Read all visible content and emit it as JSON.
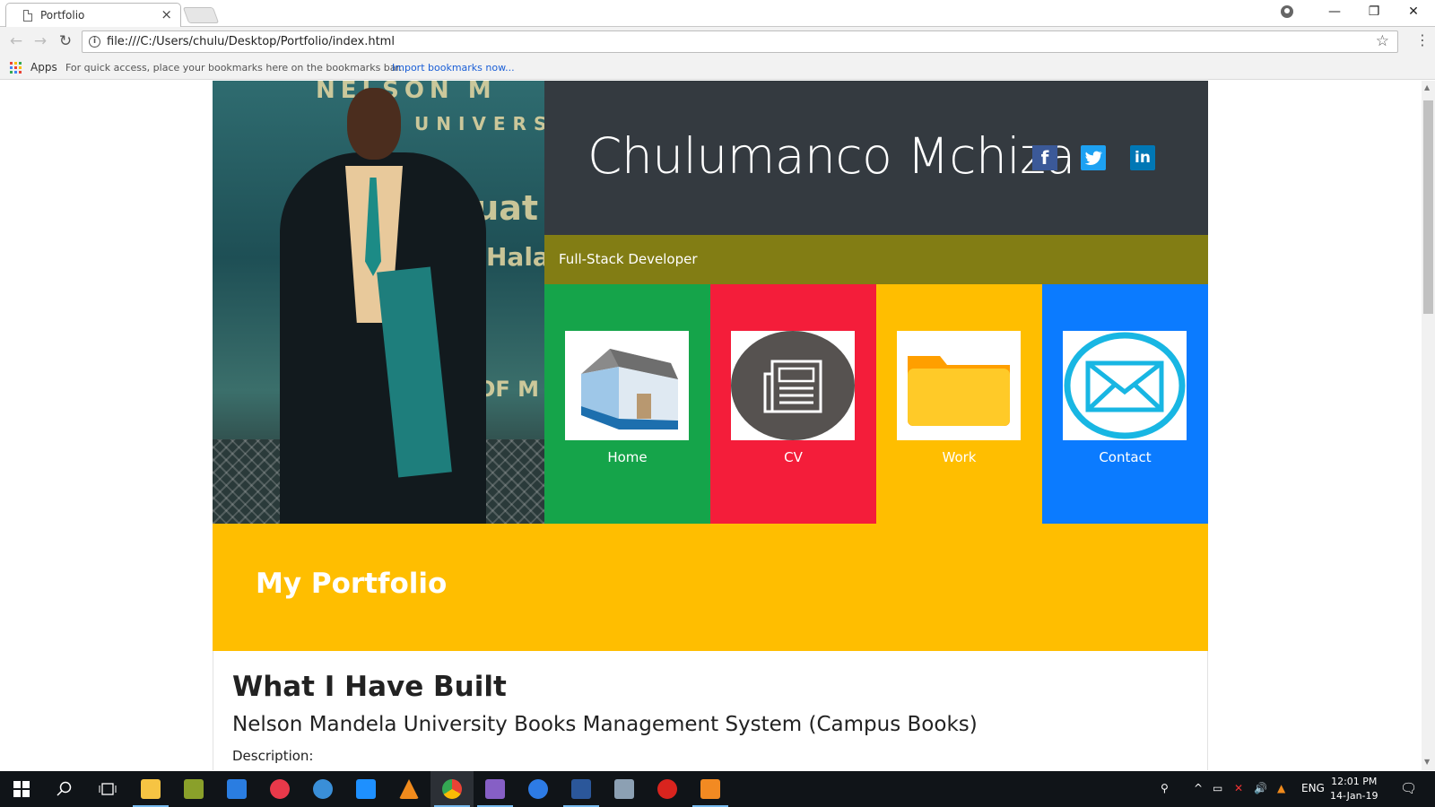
{
  "browser": {
    "tab_title": "Portfolio",
    "tab_close": "×",
    "url": "file:///C:/Users/chulu/Desktop/Portfolio/index.html",
    "window_controls": {
      "minimize": "—",
      "maximize": "❐",
      "close": "✕"
    }
  },
  "bookmarks": {
    "apps_label": "Apps",
    "hint": "For quick access, place your bookmarks here on the bookmarks bar.",
    "import_link": "Import bookmarks now..."
  },
  "header": {
    "name": "Chulumanco Mchiza",
    "subtitle": "Full-Stack Developer",
    "social": [
      {
        "icon": "facebook-icon",
        "glyph": "f",
        "color": "#3b5998"
      },
      {
        "icon": "twitter-icon",
        "glyph": "🐦",
        "color": "#1da1f2"
      },
      {
        "icon": "linkedin-icon",
        "glyph": "in",
        "color": "#0077b5"
      }
    ]
  },
  "nav_tiles": [
    {
      "label": "Home",
      "icon": "house-icon",
      "color": "#15a44a"
    },
    {
      "label": "CV",
      "icon": "newspaper-icon",
      "color": "#f41d3a"
    },
    {
      "label": "Work",
      "icon": "folder-icon",
      "color": "#ffbe00"
    },
    {
      "label": "Contact",
      "icon": "envelope-icon",
      "color": "#0b7bff"
    }
  ],
  "photo": {
    "banner_line1": "NELSON M",
    "banner_line2": "UNIVERS",
    "banner_line3": "duat",
    "banner_line4": "Hala",
    "banner_line5": "OF M"
  },
  "portfolio": {
    "title": "My Portfolio",
    "section_title": "What I Have Built",
    "project_title": "Nelson Mandela University Books Management System (Campus Books)",
    "description_label": "Description:"
  },
  "taskbar": {
    "language": "ENG",
    "time": "12:01 PM",
    "date": "14-Jan-19"
  },
  "colors": {
    "dark_header": "#343a40",
    "olive": "#827d14",
    "green": "#15a44a",
    "red": "#f41d3a",
    "yellow": "#ffbe00",
    "blue": "#0b7bff"
  }
}
